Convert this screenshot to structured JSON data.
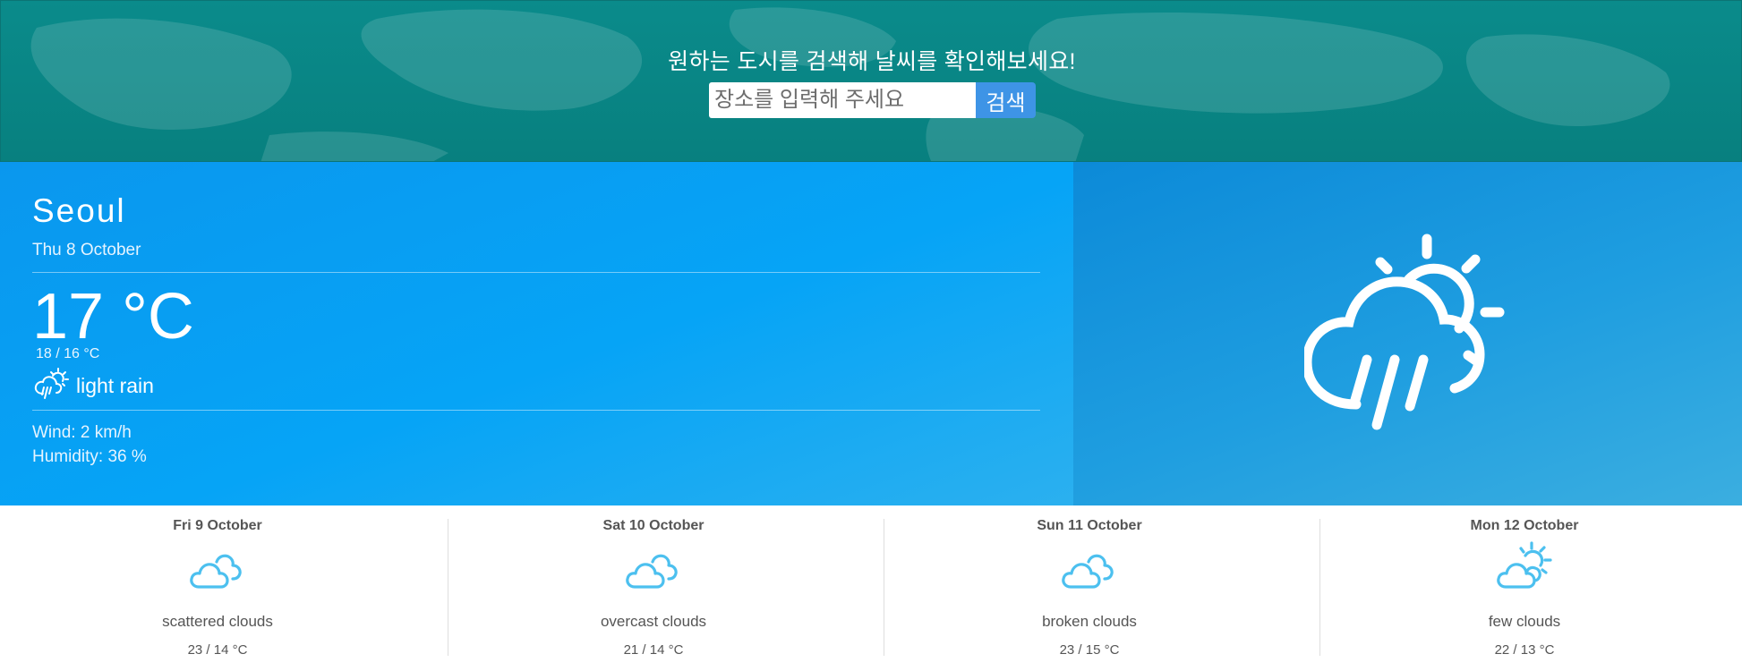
{
  "header": {
    "title": "원하는 도시를 검색해 날씨를 확인해보세요!",
    "search_placeholder": "장소를 입력해 주세요",
    "search_value": "",
    "search_button": "검색"
  },
  "current": {
    "city": "Seoul",
    "date": "Thu 8 October",
    "temperature": "17 °C",
    "range": "18 / 16 °C",
    "condition": "light rain",
    "condition_icon": "cloud-sun-rain-icon",
    "wind": "Wind: 2 km/h",
    "humidity": "Humidity: 36 %"
  },
  "forecast": [
    {
      "date": "Fri 9 October",
      "description": "scattered clouds",
      "range": "23 / 14 °C",
      "icon": "clouds-icon"
    },
    {
      "date": "Sat 10 October",
      "description": "overcast clouds",
      "range": "21 / 14 °C",
      "icon": "clouds-icon"
    },
    {
      "date": "Sun 11 October",
      "description": "broken clouds",
      "range": "23 / 15 °C",
      "icon": "clouds-icon"
    },
    {
      "date": "Mon 12 October",
      "description": "few clouds",
      "range": "22 / 13 °C",
      "icon": "cloud-sun-icon"
    }
  ],
  "colors": {
    "header_bg": "#0a8b8b",
    "main_bg": "#06a4f6",
    "search_button_bg": "#3e94e6",
    "forecast_icon": "#4cc0ef"
  }
}
